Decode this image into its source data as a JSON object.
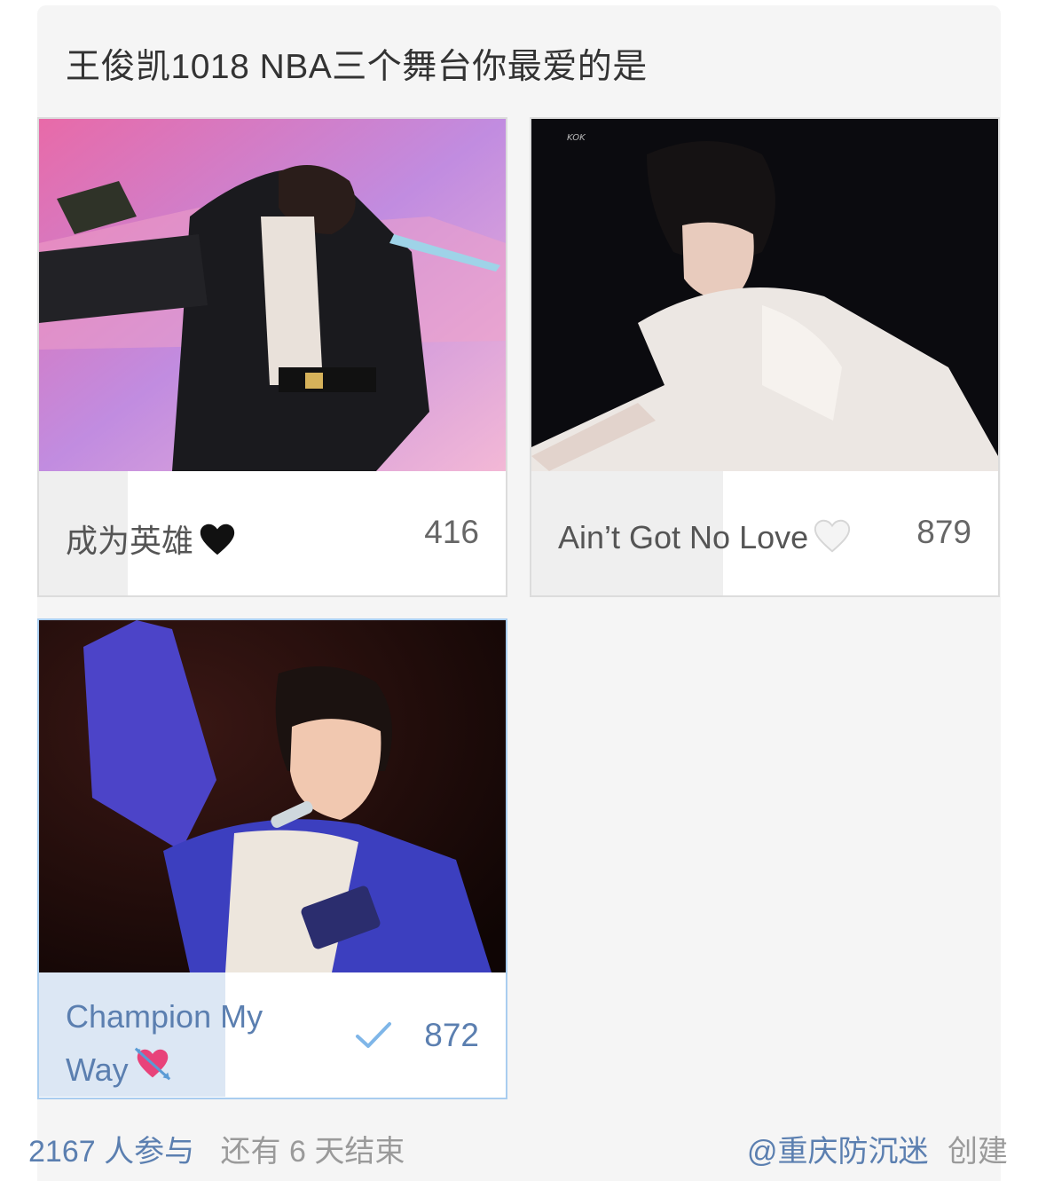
{
  "poll": {
    "title": "王俊凯1018 NBA三个舞台你最爱的是"
  },
  "options": [
    {
      "label": "成为英雄",
      "emoji_icon": "black-heart-icon",
      "votes": "416",
      "share": 0.19,
      "selected": false
    },
    {
      "label": "Ain’t Got No Love",
      "emoji_icon": "white-heart-icon",
      "votes": "879",
      "share": 0.41,
      "selected": false
    },
    {
      "label": "Champion My Way",
      "emoji_icon": "heart-with-arrow-icon",
      "votes": "872",
      "share": 0.4,
      "selected": true
    }
  ],
  "footer": {
    "participants": "2167 人参与",
    "remaining": "还有 6 天结束",
    "creator_handle": "@重庆防沉迷",
    "created_label": "创建"
  },
  "colors": {
    "accent": "#5b7fb0",
    "selected_border": "#a9cdef",
    "selected_fill": "#dce7f4",
    "bar_fill": "#efefef"
  }
}
